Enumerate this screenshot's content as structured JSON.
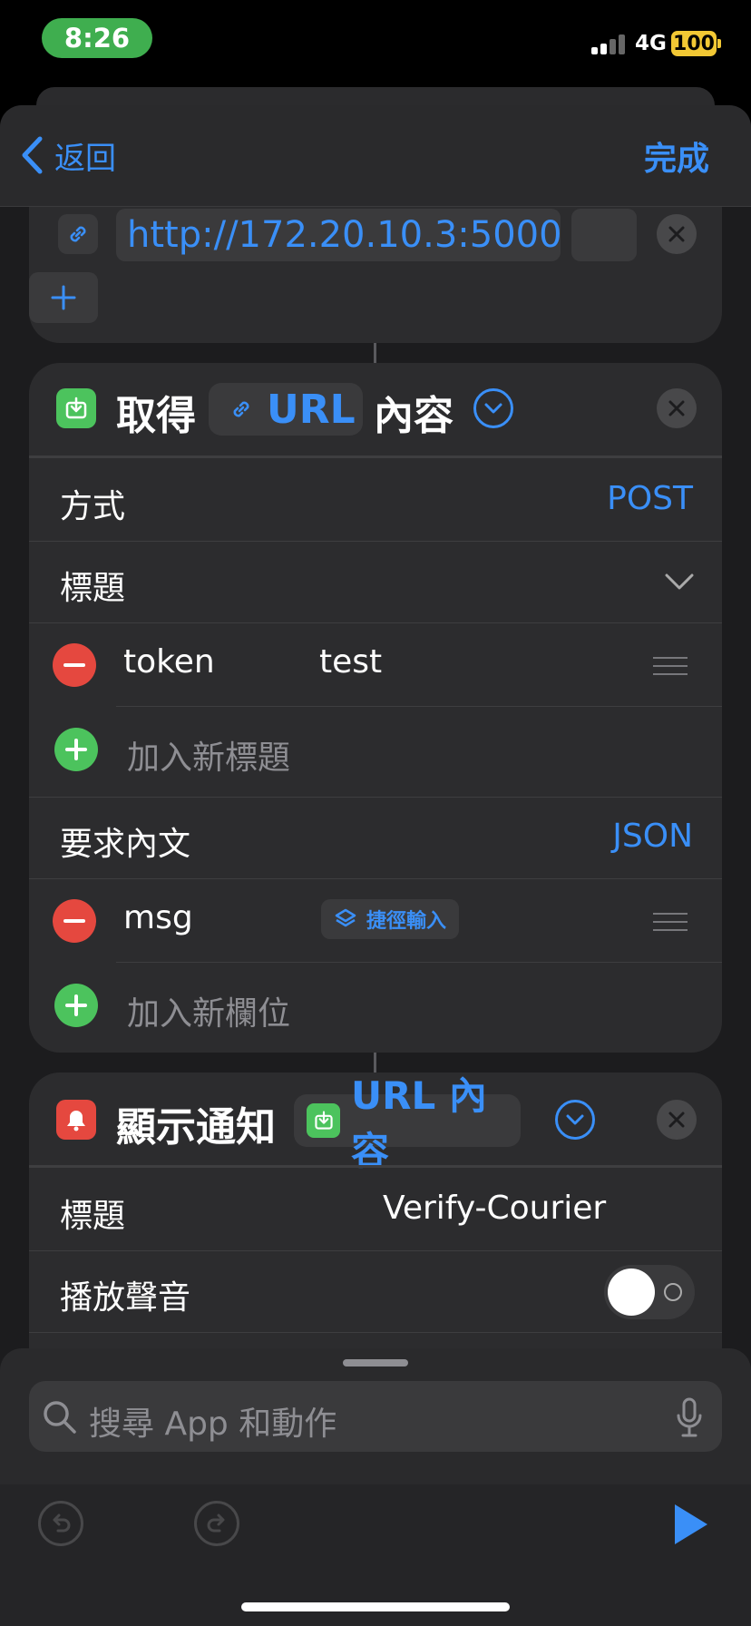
{
  "status_bar": {
    "time": "8:26",
    "network": "4G",
    "battery": "100"
  },
  "nav": {
    "back_label": "返回",
    "done_label": "完成"
  },
  "url_action": {
    "url": "http://172.20.10.3:5000"
  },
  "get_contents": {
    "title_left": "取得",
    "chip_label": "URL",
    "title_right": "內容",
    "method_label": "方式",
    "method_value": "POST",
    "headers_label": "標題",
    "headers": [
      {
        "key": "token",
        "value": "test"
      }
    ],
    "add_header_label": "加入新標題",
    "body_label": "要求內文",
    "body_value": "JSON",
    "fields": [
      {
        "key": "msg",
        "value_chip": "捷徑輸入"
      }
    ],
    "add_field_label": "加入新欄位"
  },
  "notification": {
    "title": "顯示通知",
    "chip_label": "URL 內容",
    "title_label": "標題",
    "title_value": "Verify-Courier",
    "sound_label": "播放聲音",
    "sound_on": false
  },
  "search": {
    "placeholder": "搜尋 App 和動作"
  },
  "colors": {
    "accent": "#3a8ff7",
    "green": "#4cc35d",
    "red": "#e5483f",
    "card": "#2c2c2e"
  }
}
